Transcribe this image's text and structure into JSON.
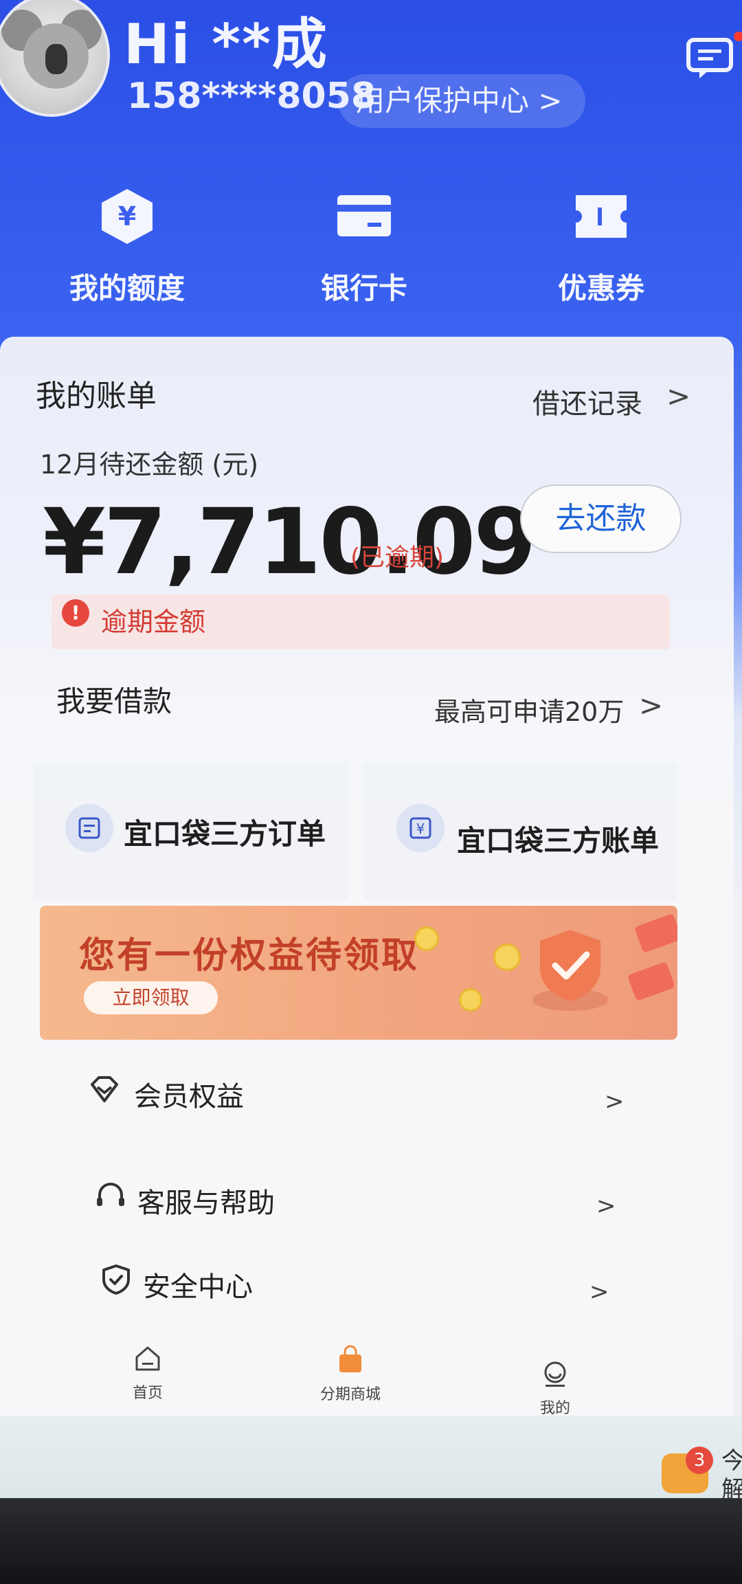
{
  "header": {
    "greeting": "Hi **成",
    "phone": "158****8058",
    "protect_center": "用户保护中心 >"
  },
  "quick_entries": [
    {
      "label": "我的额度",
      "icon": "yuan-hexagon-icon"
    },
    {
      "label": "银行卡",
      "icon": "bank-card-icon"
    },
    {
      "label": "优惠券",
      "icon": "coupon-icon"
    }
  ],
  "bill": {
    "title": "我的账单",
    "record_link": "借还记录",
    "due_label": "12月待还金额 (元)",
    "amount": "¥7,710.09",
    "status": "(已逾期)",
    "repay_button": "去还款",
    "alert": "逾期金额",
    "alert_icon": "!"
  },
  "borrow": {
    "title": "我要借款",
    "max": "最高可申请20万"
  },
  "tiles": [
    {
      "label": "宜口袋三方订单",
      "icon": "order-icon"
    },
    {
      "label": "宜口袋三方账单",
      "icon": "yuan-bill-icon"
    }
  ],
  "banner": {
    "title": "您有一份权益待领取",
    "button": "立即领取"
  },
  "menu": [
    {
      "label": "会员权益",
      "icon": "member-diamond-icon"
    },
    {
      "label": "客服与帮助",
      "icon": "headset-icon"
    },
    {
      "label": "安全中心",
      "icon": "shield-check-icon"
    }
  ],
  "chevron": ">",
  "tabbar": [
    {
      "label": "首页",
      "icon": "home-icon"
    },
    {
      "label": "分期商城",
      "icon": "shopping-bag-icon"
    },
    {
      "label": "我的",
      "icon": "profile-icon"
    }
  ],
  "bottom": {
    "badge_count": "3",
    "text": "今\n解"
  },
  "colors": {
    "header_blue": "#2b4fe6",
    "overdue_red": "#d8443a",
    "link_blue": "#1f63d8",
    "banner_orange": "#f3a981"
  }
}
